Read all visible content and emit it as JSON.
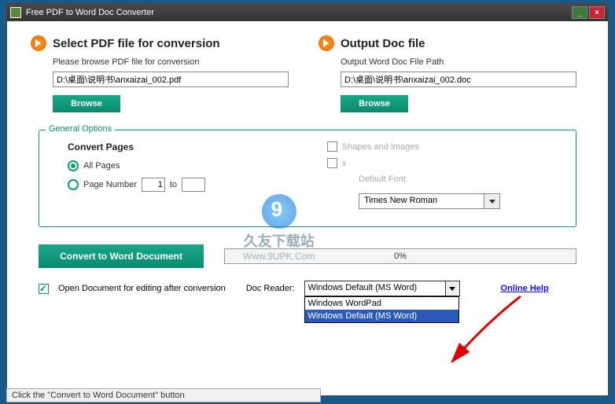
{
  "titlebar": {
    "title": "Free PDF to Word Doc Converter"
  },
  "left": {
    "title": "Select PDF file for conversion",
    "sub": "Please browse PDF file for conversion",
    "path": "D:\\桌面\\说明书\\anxaizai_002.pdf",
    "browse": "Browse"
  },
  "right": {
    "title": "Output Doc file",
    "sub": "Output Word Doc File Path",
    "path": "D:\\桌面\\说明书\\anxaizai_002.doc",
    "browse": "Browse"
  },
  "general": {
    "legend": "General Options",
    "convert_title": "Convert Pages",
    "all": "All Pages",
    "pagenum": "Page Number",
    "pagefrom": "1",
    "to": "to",
    "pageto": "",
    "shapes": "Shapes and Images",
    "use_font": "x",
    "default_font": "Default Font",
    "font": "Times New Roman"
  },
  "convert": {
    "button": "Convert to Word Document",
    "progress": "0%"
  },
  "bottom": {
    "open_after": "Open Document for editing after conversion",
    "reader_label": "Doc Reader:",
    "reader_value": "Windows Default (MS Word)",
    "options": [
      "Windows WordPad",
      "Windows Default (MS Word)"
    ],
    "help": "Online Help"
  },
  "status": "Click the \"Convert to Word Document\" button",
  "watermark": {
    "t1": "久友下载站",
    "t2": "Www.9UPK.Com"
  }
}
